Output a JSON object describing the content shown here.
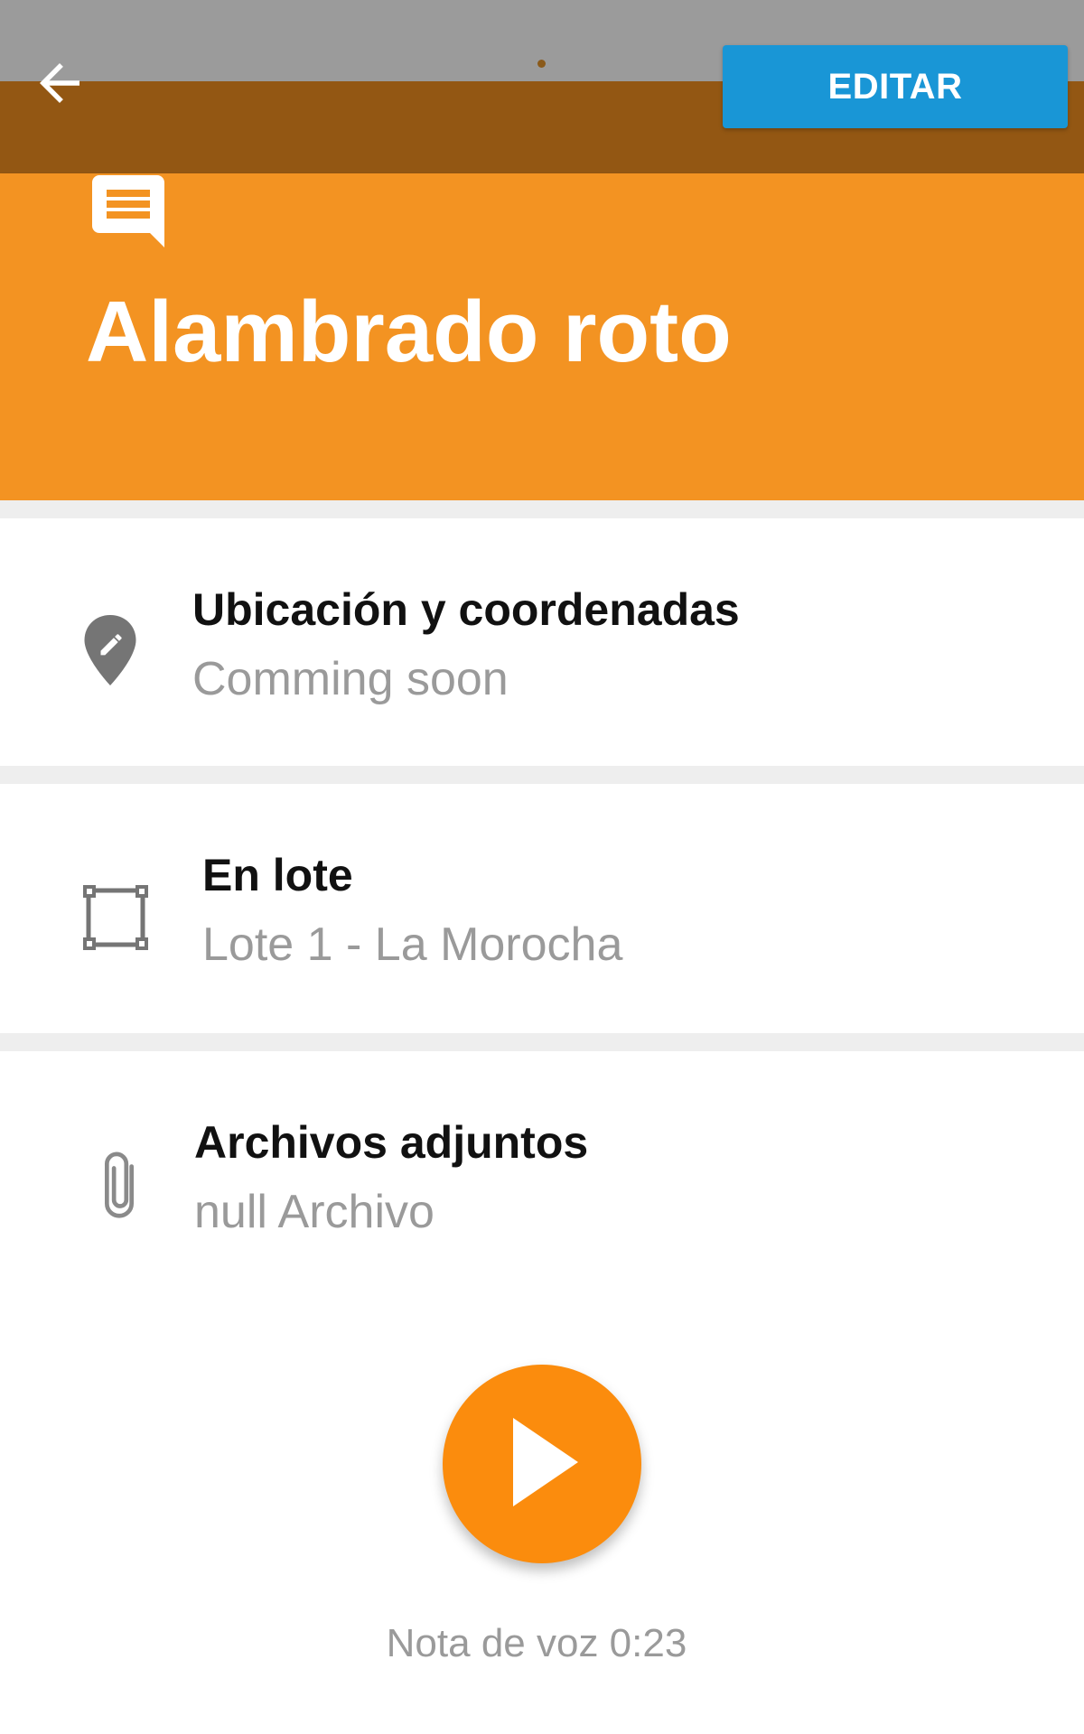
{
  "toolbar": {
    "back_icon": "arrow-back-icon",
    "edit_label": "EDITAR",
    "edit_color": "#1996d6",
    "toolbar_color": "#935713"
  },
  "header": {
    "icon": "comment-icon",
    "title": "Alambrado roto",
    "color": "#f39322"
  },
  "rows": [
    {
      "icon": "location-edit-icon",
      "title": "Ubicación y coordenadas",
      "subtitle": "Comming soon"
    },
    {
      "icon": "boundary-square-icon",
      "title": "En lote",
      "subtitle": "Lote 1 - La Morocha"
    },
    {
      "icon": "paperclip-icon",
      "title": "Archivos adjuntos",
      "subtitle": "null Archivo"
    }
  ],
  "voice_note": {
    "icon": "play-icon",
    "label": "Nota de voz 0:23",
    "button_color": "#fb8c0d"
  }
}
